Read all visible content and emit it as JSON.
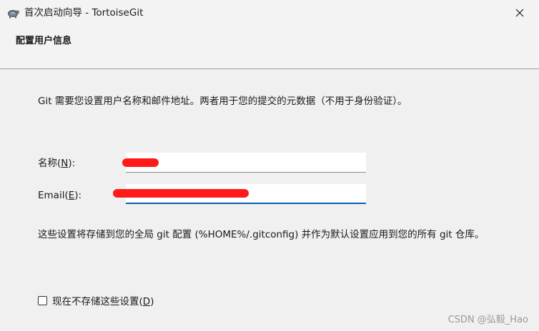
{
  "window": {
    "title": "首次启动向导 - TortoiseGit",
    "icon": "tortoise-icon",
    "close_icon": "close-icon"
  },
  "header": {
    "title": "配置用户信息"
  },
  "description": "Git 需要您设置用户名称和邮件地址。两者用于您的提交的元数据（不用于身份验证）。",
  "form": {
    "name_label": "名称(",
    "name_accel": "N",
    "name_label_end": "):",
    "name_value": "",
    "email_label": "Email(",
    "email_accel": "E",
    "email_label_end": "):",
    "email_value": ""
  },
  "note": "这些设置将存储到您的全局 git 配置 (%HOME%/.gitconfig) 并作为默认设置应用到您的所有 git 仓库。",
  "checkbox": {
    "label": "现在不存储这些设置(",
    "accel": "D",
    "label_end": ")",
    "checked": false
  },
  "watermark": "CSDN @弘毅_Hao",
  "colors": {
    "redaction": "#ff1a1a",
    "focus_underline": "#0a5fb4"
  }
}
